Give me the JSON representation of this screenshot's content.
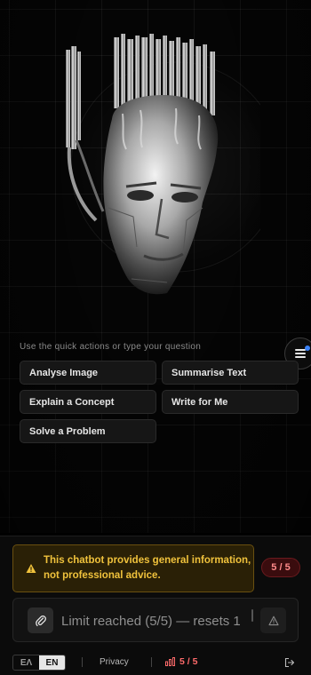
{
  "hero": {
    "image": "chrome-robot-head-illustration"
  },
  "quick_actions": {
    "hint": "Use the quick actions or type your question",
    "items": [
      {
        "label": "Analyse Image"
      },
      {
        "label": "Summarise Text"
      },
      {
        "label": "Explain a Concept"
      },
      {
        "label": "Write for Me"
      },
      {
        "label": "Solve a Problem"
      }
    ]
  },
  "menu_button": {
    "icon": "menu-icon",
    "indicator_color": "#3b82f6"
  },
  "disclaimer": {
    "icon": "warning-icon",
    "text": "This chatbot provides general information, not professional advice.",
    "color": "#f0c23c"
  },
  "message_count": "5 / 5",
  "composer": {
    "attach_icon": "paperclip-icon",
    "value": "Limit reached (5/5) — resets 1",
    "send_icon": "alert-triangle-icon"
  },
  "footer": {
    "lang_options": [
      "EΛ",
      "EN"
    ],
    "lang_selected": "EN",
    "privacy": "Privacy",
    "usage": "5 / 5",
    "usage_icon": "bar-chart-icon",
    "logout_icon": "logout-icon"
  },
  "colors": {
    "accent_warning": "#f0c23c",
    "limit_red": "#ff6b6b",
    "background": "#000000"
  }
}
